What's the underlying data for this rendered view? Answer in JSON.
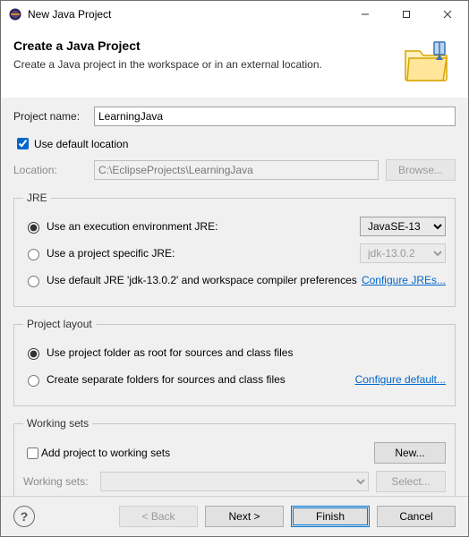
{
  "window": {
    "title": "New Java Project"
  },
  "header": {
    "title": "Create a Java Project",
    "subtitle": "Create a Java project in the workspace or in an external location."
  },
  "project": {
    "name_label": "Project name:",
    "name_value": "LearningJava",
    "use_default_label": "Use default location",
    "location_label": "Location:",
    "location_value": "C:\\EclipseProjects\\LearningJava",
    "browse_label": "Browse..."
  },
  "jre": {
    "legend": "JRE",
    "opt_env": "Use an execution environment JRE:",
    "env_value": "JavaSE-13",
    "opt_proj": "Use a project specific JRE:",
    "proj_value": "jdk-13.0.2",
    "opt_default": "Use default JRE 'jdk-13.0.2' and workspace compiler preferences",
    "configure_link": "Configure JREs..."
  },
  "layout": {
    "legend": "Project layout",
    "opt_root": "Use project folder as root for sources and class files",
    "opt_sep": "Create separate folders for sources and class files",
    "configure_link": "Configure default..."
  },
  "ws": {
    "legend": "Working sets",
    "add_label": "Add project to working sets",
    "new_label": "New...",
    "sets_label": "Working sets:",
    "select_label": "Select..."
  },
  "footer": {
    "back": "< Back",
    "next": "Next >",
    "finish": "Finish",
    "cancel": "Cancel"
  }
}
